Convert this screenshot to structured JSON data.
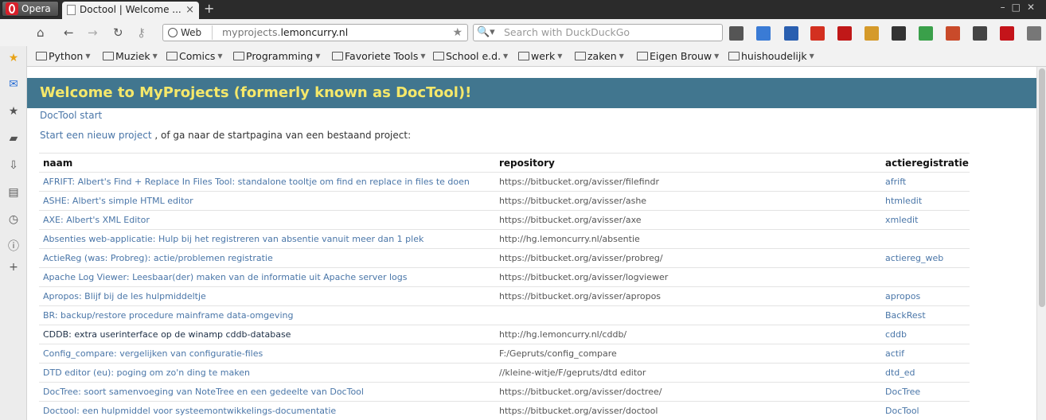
{
  "browser": {
    "menu_label": "Opera",
    "tab_title": "Doctool | Welcome ...",
    "tab_close": "×",
    "new_tab": "+",
    "url_scheme_label": "Web",
    "url_prefix": "myprojects.",
    "url_domain": "lemoncurry.nl",
    "search_placeholder": "Search with DuckDuckGo"
  },
  "bookmarks": [
    "Python",
    "Muziek",
    "Comics",
    "Programming",
    "Favoriete Tools",
    "School e.d.",
    "werk",
    "zaken",
    "Eigen Brouw",
    "huishoudelijk"
  ],
  "extensions": [
    {
      "name": "key-icon",
      "color": "#555555"
    },
    {
      "name": "off-badge-icon",
      "color": "#3a7bd5"
    },
    {
      "name": "blue-shield-icon",
      "color": "#2a5fb0"
    },
    {
      "name": "puzzle-red-icon",
      "color": "#d33020"
    },
    {
      "name": "acrobat-icon",
      "color": "#c01818"
    },
    {
      "name": "palette-icon",
      "color": "#d59a2a"
    },
    {
      "name": "toolbox-icon",
      "color": "#333333"
    },
    {
      "name": "green-refresh-icon",
      "color": "#3aa04a"
    },
    {
      "name": "bars-icon",
      "color": "#c94a2a"
    },
    {
      "name": "screen-icon",
      "color": "#444444"
    },
    {
      "name": "adblock-icon",
      "color": "#c4141a"
    },
    {
      "name": "notification-icon",
      "color": "#777777"
    }
  ],
  "page": {
    "heading": "Welcome to MyProjects (formerly known as DocTool)!",
    "doctool_link": "DocTool start",
    "new_project_link": "Start een nieuw project",
    "intro_rest": " , of ga naar de startpagina van een bestaand project:"
  },
  "table": {
    "headers": [
      "naam",
      "repository",
      "actieregistratie"
    ],
    "rows": [
      {
        "name": "AFRIFT: Albert's Find + Replace In Files Tool: standalone tooltje om find en replace in files te doen",
        "repo": "https://bitbucket.org/avisser/filefindr",
        "actie": "afrift"
      },
      {
        "name": "ASHE: Albert's simple HTML editor",
        "repo": "https://bitbucket.org/avisser/ashe",
        "actie": "htmledit"
      },
      {
        "name": "AXE: Albert's XML Editor",
        "repo": "https://bitbucket.org/avisser/axe",
        "actie": "xmledit"
      },
      {
        "name": "Absenties web-applicatie: Hulp bij het registreren van absentie vanuit meer dan 1 plek",
        "repo": "http://hg.lemoncurry.nl/absentie",
        "actie": ""
      },
      {
        "name": "ActieReg (was: Probreg): actie/problemen registratie",
        "repo": "https://bitbucket.org/avisser/probreg/",
        "actie": "actiereg_web"
      },
      {
        "name": "Apache Log Viewer: Leesbaar(der) maken van de informatie uit Apache server logs",
        "repo": "https://bitbucket.org/avisser/logviewer",
        "actie": ""
      },
      {
        "name": "Apropos: Blijf bij de les hulpmiddeltje",
        "repo": "https://bitbucket.org/avisser/apropos",
        "actie": "apropos"
      },
      {
        "name": "BR: backup/restore procedure mainframe data-omgeving",
        "repo": "",
        "actie": "BackRest"
      },
      {
        "name": "CDDB: extra userinterface op de winamp cddb-database",
        "repo": "http://hg.lemoncurry.nl/cddb/",
        "actie": "cddb",
        "visited": true
      },
      {
        "name": "Config_compare: vergelijken van configuratie-files",
        "repo": "F:/Gepruts/config_compare",
        "actie": "actif"
      },
      {
        "name": "DTD editor (eu): poging om zo'n ding te maken",
        "repo": "//kleine-witje/F/gepruts/dtd editor",
        "actie": "dtd_ed"
      },
      {
        "name": "DocTree: soort samenvoeging van NoteTree en een gedeelte van DocTool",
        "repo": "https://bitbucket.org/avisser/doctree/",
        "actie": "DocTree"
      },
      {
        "name": "Doctool: een hulpmiddel voor systeemontwikkelings-documentatie",
        "repo": "https://bitbucket.org/avisser/doctool",
        "actie": "DocTool"
      }
    ]
  }
}
